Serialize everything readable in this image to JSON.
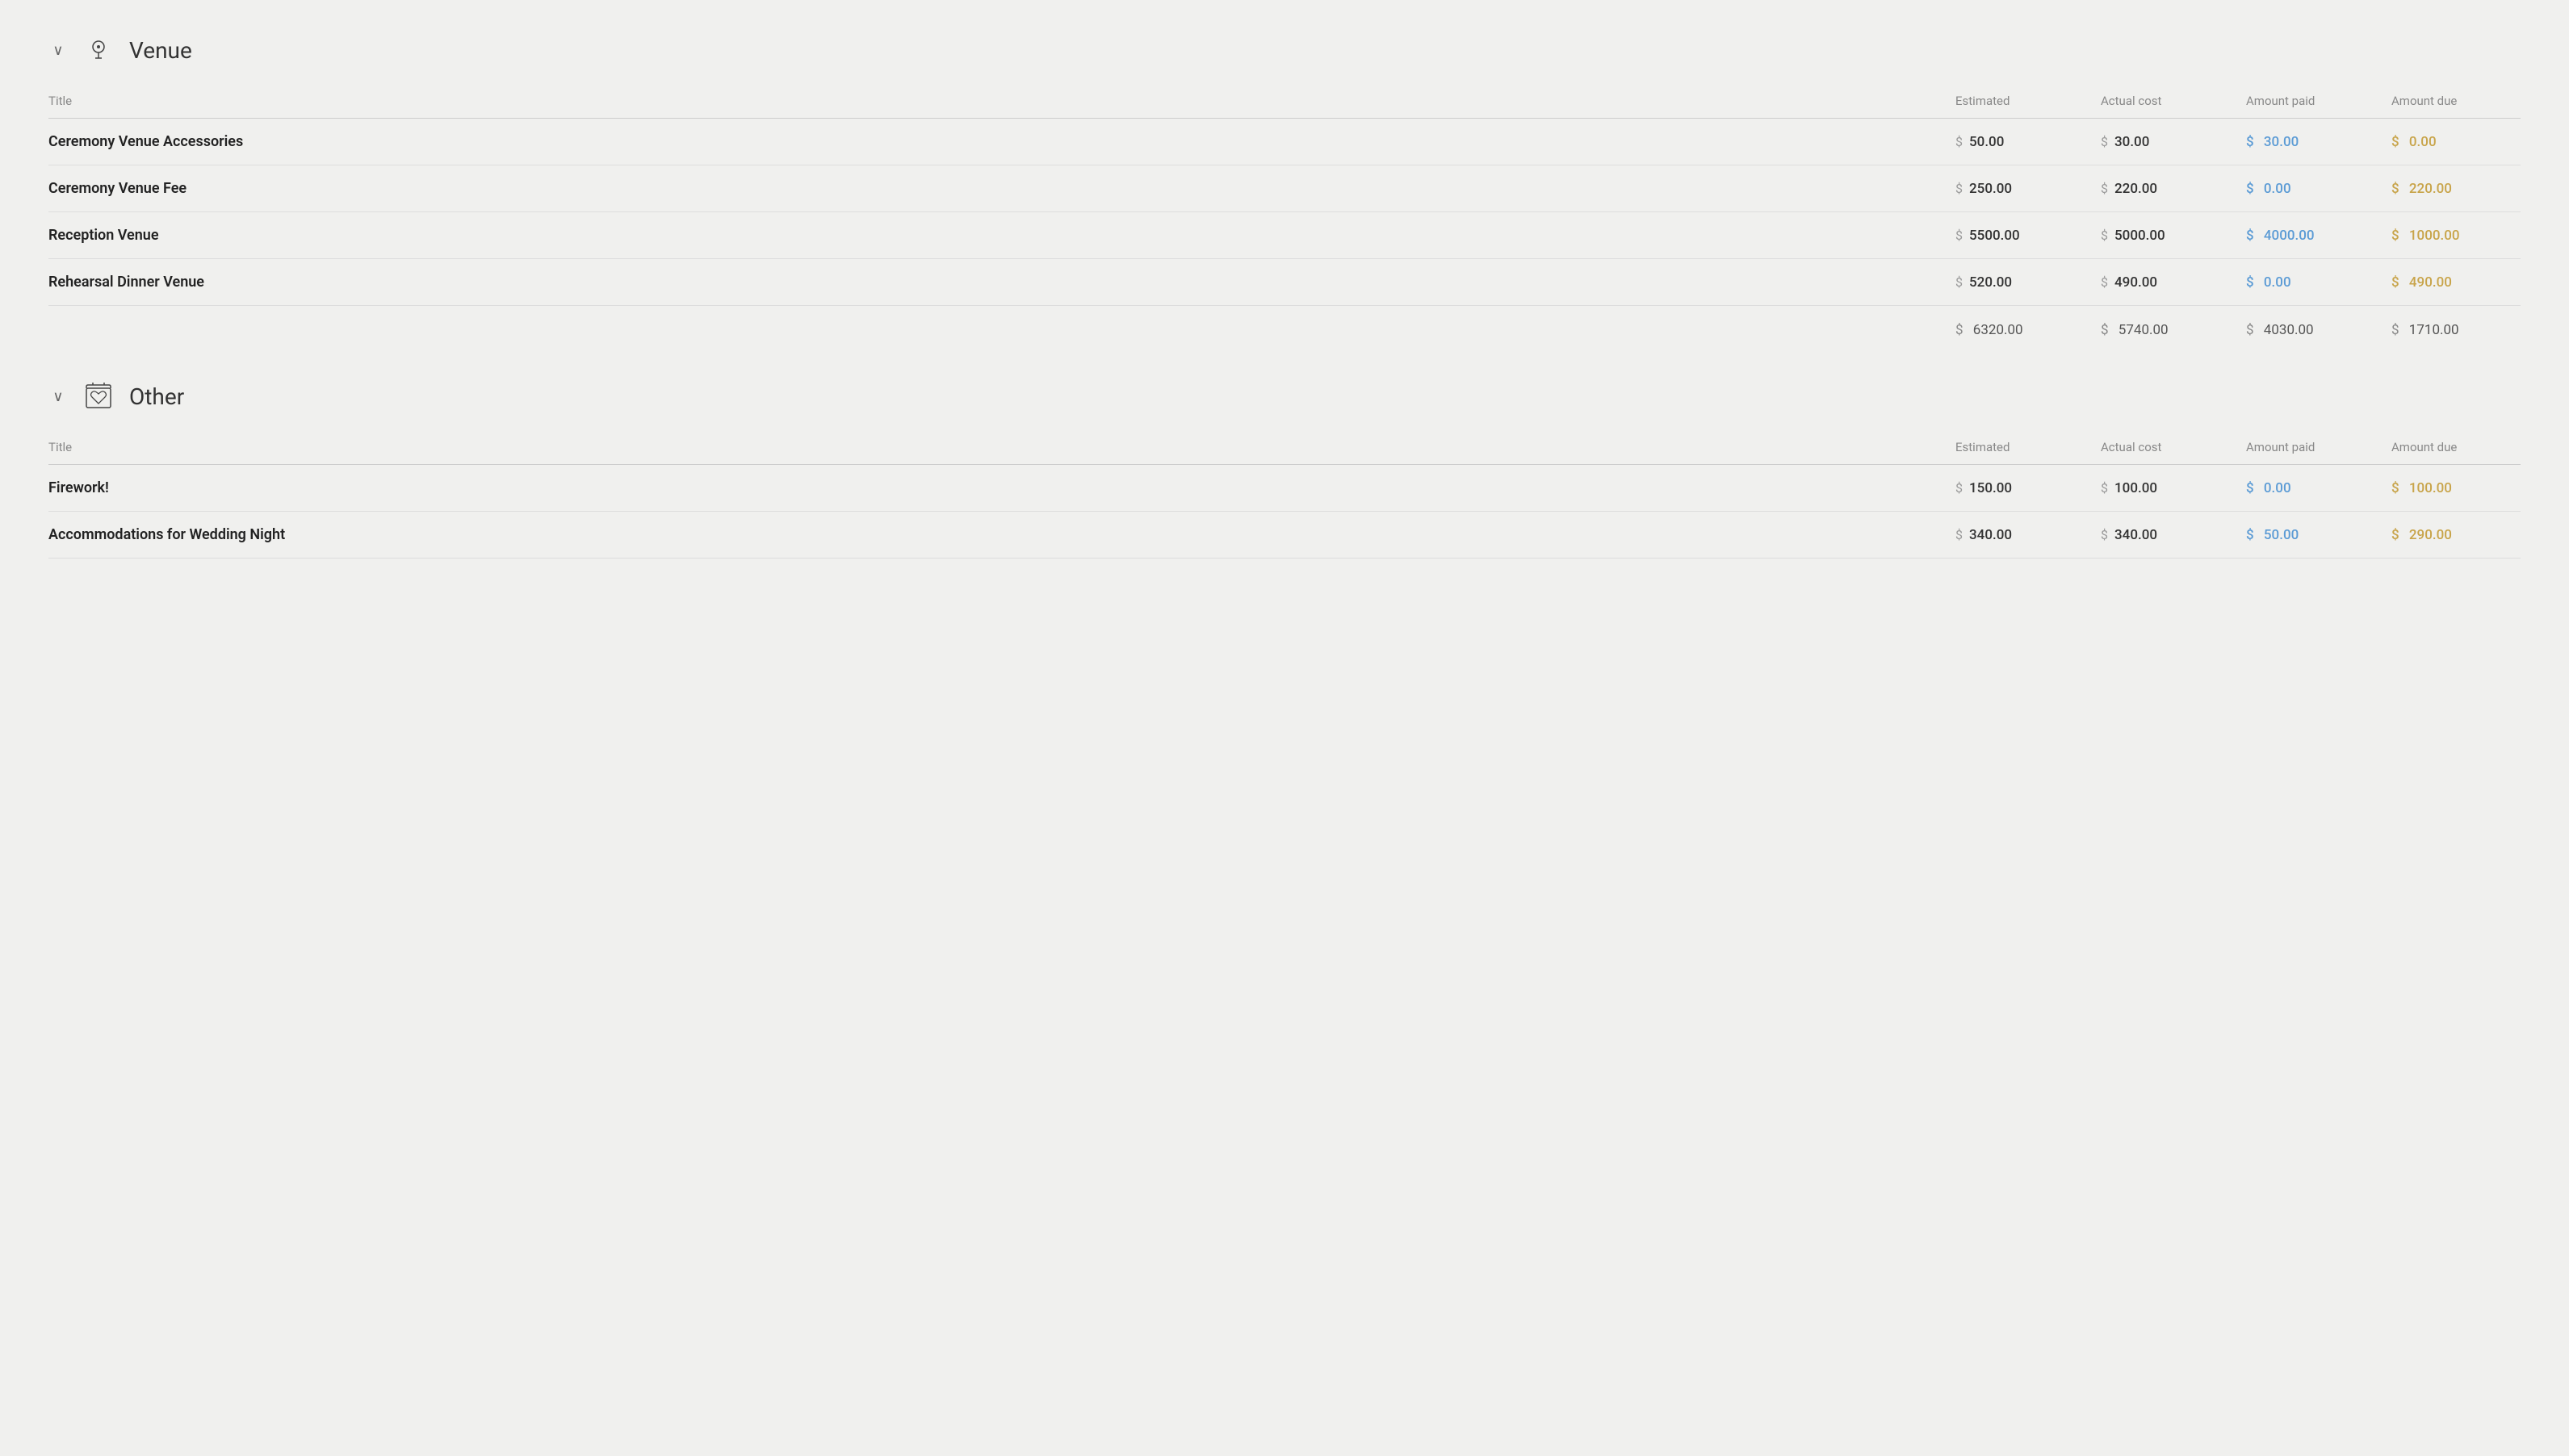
{
  "sections": [
    {
      "id": "venue",
      "title": "Venue",
      "icon": "venue-icon",
      "columns": {
        "title": "Title",
        "estimated": "Estimated",
        "actual_cost": "Actual cost",
        "amount_paid": "Amount paid",
        "amount_due": "Amount due"
      },
      "items": [
        {
          "title": "Ceremony Venue Accessories",
          "estimated": "50.00",
          "actual_cost": "30.00",
          "amount_paid": "30.00",
          "amount_due": "0.00"
        },
        {
          "title": "Ceremony Venue Fee",
          "estimated": "250.00",
          "actual_cost": "220.00",
          "amount_paid": "0.00",
          "amount_due": "220.00"
        },
        {
          "title": "Reception Venue",
          "estimated": "5500.00",
          "actual_cost": "5000.00",
          "amount_paid": "4000.00",
          "amount_due": "1000.00"
        },
        {
          "title": "Rehearsal Dinner Venue",
          "estimated": "520.00",
          "actual_cost": "490.00",
          "amount_paid": "0.00",
          "amount_due": "490.00"
        }
      ],
      "totals": {
        "estimated": "6320.00",
        "actual_cost": "5740.00",
        "amount_paid": "4030.00",
        "amount_due": "1710.00"
      }
    },
    {
      "id": "other",
      "title": "Other",
      "icon": "other-icon",
      "columns": {
        "title": "Title",
        "estimated": "Estimated",
        "actual_cost": "Actual cost",
        "amount_paid": "Amount paid",
        "amount_due": "Amount due"
      },
      "items": [
        {
          "title": "Firework!",
          "estimated": "150.00",
          "actual_cost": "100.00",
          "amount_paid": "0.00",
          "amount_due": "100.00"
        },
        {
          "title": "Accommodations for Wedding Night",
          "estimated": "340.00",
          "actual_cost": "340.00",
          "amount_paid": "50.00",
          "amount_due": "290.00"
        }
      ],
      "totals": null
    }
  ],
  "chevron_down": "∨",
  "dollar_sign": "$"
}
